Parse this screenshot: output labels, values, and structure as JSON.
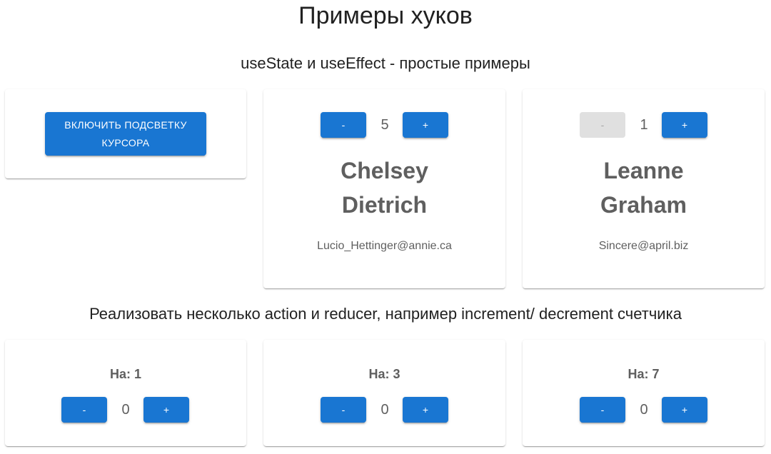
{
  "page": {
    "title": "Примеры хуков"
  },
  "sections": {
    "hooks": "useState и useEffect - простые примеры",
    "reducers": "Реализовать несколько action и reducer, например increment/ decrement счетчика"
  },
  "cursor_card": {
    "button_label": "ВКЛЮЧИТЬ ПОДСВЕТКУ КУРСОРА"
  },
  "user_cards": [
    {
      "minus": "-",
      "plus": "+",
      "count": "5",
      "first_name": "Chelsey",
      "last_name": "Dietrich",
      "email": "Lucio_Hettinger@annie.ca",
      "minus_disabled": false
    },
    {
      "minus": "-",
      "plus": "+",
      "count": "1",
      "first_name": "Leanne",
      "last_name": "Graham",
      "email": "Sincere@april.biz",
      "minus_disabled": true
    }
  ],
  "counter_cards": [
    {
      "step_label": "На: 1",
      "minus": "-",
      "plus": "+",
      "value": "0"
    },
    {
      "step_label": "На: 3",
      "minus": "-",
      "plus": "+",
      "value": "0"
    },
    {
      "step_label": "На: 7",
      "minus": "-",
      "plus": "+",
      "value": "0"
    }
  ],
  "colors": {
    "primary": "#1976d2",
    "disabled_bg": "#e0e0e0",
    "muted_text": "#5f5f5f"
  }
}
